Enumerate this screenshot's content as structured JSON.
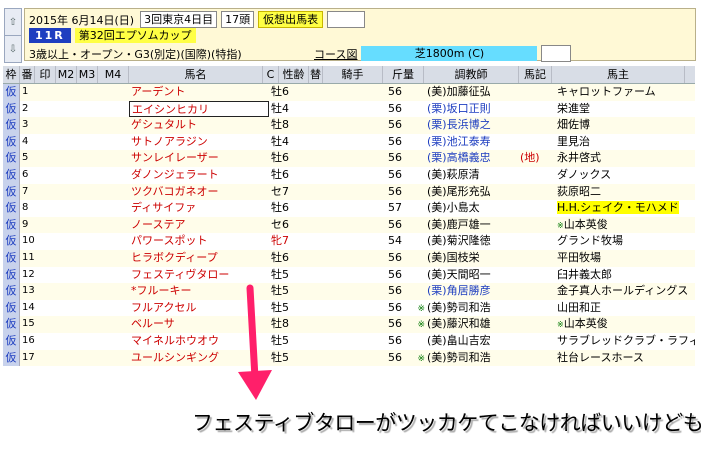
{
  "header": {
    "date": "2015年 6月14日(日)",
    "meeting": "3回東京4日目",
    "runners": "17頭",
    "badge": "仮想出馬表",
    "race_no": "11R",
    "race_name": "第32回エプソムカップ",
    "conditions": "3歳以上・オープン・G3(別定)(国際)(特指)",
    "course_link": "コース図",
    "course": "芝1800m (C)"
  },
  "columns": [
    "枠",
    "番",
    "印",
    "M2",
    "M3",
    "M4",
    "馬名",
    "C",
    "性齢",
    "替",
    "騎手",
    "斤量",
    "調教師",
    "馬記",
    "馬主"
  ],
  "waku_label": "仮",
  "horses": [
    {
      "no": "1",
      "name": "アーデント",
      "sex_age": "牡6",
      "kin": "56",
      "region": "(美)",
      "trainer": "加藤征弘",
      "mark": "",
      "owner": "キャロットファーム",
      "trainer_blue": false,
      "owner_hl": false,
      "sex_red": false,
      "gm": false
    },
    {
      "no": "2",
      "name": "エイシンヒカリ",
      "sex_age": "牡4",
      "kin": "56",
      "region": "(栗)",
      "trainer": "坂口正則",
      "mark": "",
      "owner": "栄進堂",
      "trainer_blue": true,
      "owner_hl": false,
      "sex_red": false,
      "gm": false
    },
    {
      "no": "3",
      "name": "ゲシュタルト",
      "sex_age": "牡8",
      "kin": "56",
      "region": "(栗)",
      "trainer": "長浜博之",
      "mark": "",
      "owner": "畑佐博",
      "trainer_blue": true,
      "owner_hl": false,
      "sex_red": false,
      "gm": false
    },
    {
      "no": "4",
      "name": "サトノアラジン",
      "sex_age": "牡4",
      "kin": "56",
      "region": "(栗)",
      "trainer": "池江泰寿",
      "mark": "",
      "owner": "里見治",
      "trainer_blue": true,
      "owner_hl": false,
      "sex_red": false,
      "gm": false
    },
    {
      "no": "5",
      "name": "サンレイレーザー",
      "sex_age": "牡6",
      "kin": "56",
      "region": "(栗)",
      "trainer": "高橋義忠",
      "mark": "(地)",
      "owner": "永井啓式",
      "trainer_blue": true,
      "owner_hl": false,
      "sex_red": false,
      "gm": false
    },
    {
      "no": "6",
      "name": "ダノンジェラート",
      "sex_age": "牡6",
      "kin": "56",
      "region": "(美)",
      "trainer": "萩原清",
      "mark": "",
      "owner": "ダノックス",
      "trainer_blue": false,
      "owner_hl": false,
      "sex_red": false,
      "gm": false
    },
    {
      "no": "7",
      "name": "ツクバコガネオー",
      "sex_age": "セ7",
      "kin": "56",
      "region": "(美)",
      "trainer": "尾形充弘",
      "mark": "",
      "owner": "荻原昭二",
      "trainer_blue": false,
      "owner_hl": false,
      "sex_red": false,
      "gm": false
    },
    {
      "no": "8",
      "name": "ディサイファ",
      "sex_age": "牡6",
      "kin": "57",
      "region": "(美)",
      "trainer": "小島太",
      "mark": "",
      "owner": "H.H.シェイク・モハメド",
      "trainer_blue": false,
      "owner_hl": true,
      "sex_red": false,
      "gm": false
    },
    {
      "no": "9",
      "name": "ノーステア",
      "sex_age": "セ6",
      "kin": "56",
      "region": "(美)",
      "trainer": "鹿戸雄一",
      "mark": "",
      "owner": "山本英俊",
      "trainer_blue": false,
      "owner_hl": false,
      "sex_red": false,
      "gm": false,
      "owner_gm": true
    },
    {
      "no": "10",
      "name": "パワースポット",
      "sex_age": "牝7",
      "kin": "54",
      "region": "(美)",
      "trainer": "菊沢隆徳",
      "mark": "",
      "owner": "グランド牧場",
      "trainer_blue": false,
      "owner_hl": false,
      "sex_red": true,
      "gm": false
    },
    {
      "no": "11",
      "name": "ヒラボクディープ",
      "sex_age": "牡6",
      "kin": "56",
      "region": "(美)",
      "trainer": "国枝栄",
      "mark": "",
      "owner": "平田牧場",
      "trainer_blue": false,
      "owner_hl": false,
      "sex_red": false,
      "gm": false
    },
    {
      "no": "12",
      "name": "フェスティヴタロー",
      "sex_age": "牡5",
      "kin": "56",
      "region": "(美)",
      "trainer": "天間昭一",
      "mark": "",
      "owner": "臼井義太郎",
      "trainer_blue": false,
      "owner_hl": false,
      "sex_red": false,
      "gm": false
    },
    {
      "no": "13",
      "name": "*フルーキー",
      "sex_age": "牡5",
      "kin": "56",
      "region": "(栗)",
      "trainer": "角居勝彦",
      "mark": "",
      "owner": "金子真人ホールディングス",
      "trainer_blue": true,
      "owner_hl": false,
      "sex_red": false,
      "gm": false
    },
    {
      "no": "14",
      "name": "フルアクセル",
      "sex_age": "牡5",
      "kin": "56",
      "region": "(美)",
      "trainer": "勢司和浩",
      "mark": "",
      "owner": "山田和正",
      "trainer_blue": false,
      "owner_hl": false,
      "sex_red": false,
      "gm": true
    },
    {
      "no": "15",
      "name": "ベルーサ",
      "sex_age": "牡8",
      "kin": "56",
      "region": "(美)",
      "trainer": "藤沢和雄",
      "mark": "",
      "owner": "山本英俊",
      "trainer_blue": false,
      "owner_hl": false,
      "sex_red": false,
      "gm": true,
      "owner_gm": true
    },
    {
      "no": "16",
      "name": "マイネルホウオウ",
      "sex_age": "牡5",
      "kin": "56",
      "region": "(美)",
      "trainer": "畠山吉宏",
      "mark": "",
      "owner": "サラブレッドクラブ・ラフィアン",
      "trainer_blue": false,
      "owner_hl": false,
      "sex_red": false,
      "gm": false
    },
    {
      "no": "17",
      "name": "ユールシンギング",
      "sex_age": "牡5",
      "kin": "56",
      "region": "(美)",
      "trainer": "勢司和浩",
      "mark": "",
      "owner": "社台レースホース",
      "trainer_blue": false,
      "owner_hl": false,
      "sex_red": false,
      "gm": true
    }
  ],
  "gm_mark": "※",
  "caption": "フェスティブタローがツッカケてこなければいいけども。。",
  "colors": {
    "arrow": "#ff1f6a",
    "horse_name": "#cc0000",
    "blue_trainer": "#1e3ec0",
    "header_bg": "#fff9d6"
  }
}
